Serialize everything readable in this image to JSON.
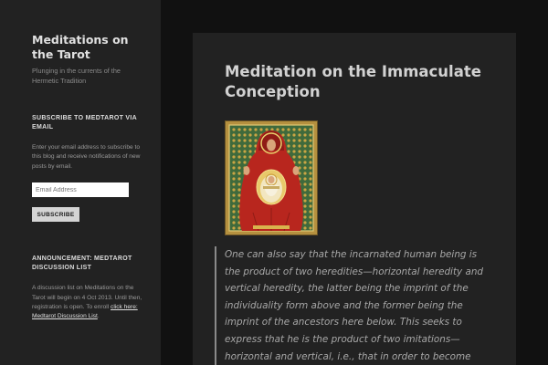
{
  "site": {
    "title": "Meditations on the Tarot",
    "tagline": "Plunging in the currents of the Hermetic Tradition"
  },
  "subscribe_widget": {
    "heading": "Subscribe to MedTarot via Email",
    "text": "Enter your email address to subscribe to this blog and receive notifications of new posts by email.",
    "email_placeholder": "Email Address",
    "button_label": "SUBSCRIBE"
  },
  "announcement_widget": {
    "heading": "Announcement: MedTarot Discussion List",
    "text": "A discussion list on Meditations on the Tarot will begin on 4 Oct 2013. Until then, registration is open. To enroll",
    "link_text": "click here: Medtarot Discussion List",
    "after_link": "."
  },
  "article": {
    "title": "Meditation on the Immaculate Conception",
    "quote": "One can also say that the incarnated human being is the product of two heredities—horizontal heredity and vertical heredity, the latter being the imprint of the individuality form above and the former being the imprint of the ancestors here below. This seeks to express that he is the product of two imitations—horizontal and vertical, i.e., that in order to become what he is he must imitate of his ancestors for"
  },
  "colors": {
    "page_background": "#111111",
    "panel_background": "#222222",
    "icon_red": "#b8261e",
    "icon_gold": "#c4a14c"
  }
}
